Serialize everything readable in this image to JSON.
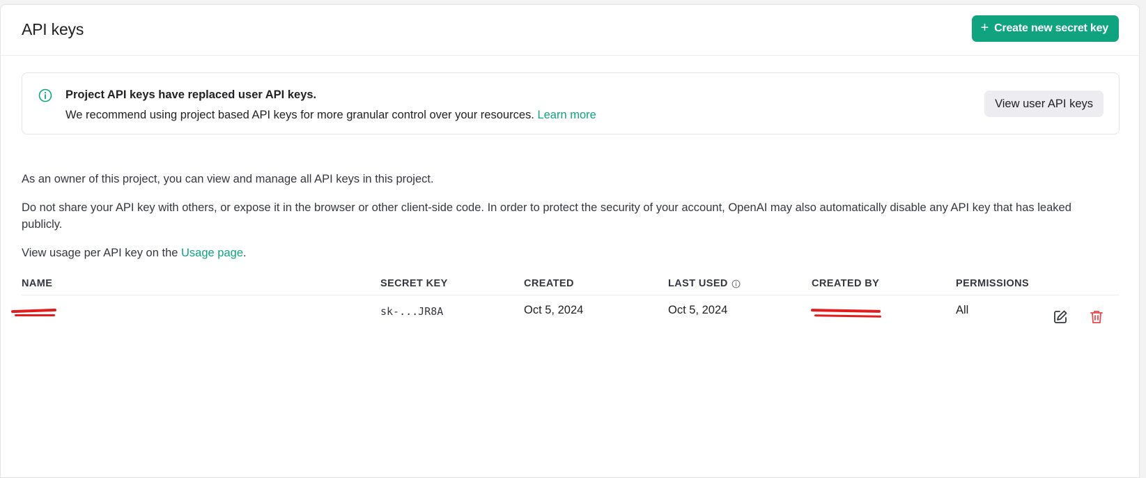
{
  "header": {
    "title": "API keys",
    "create_button_label": "Create new secret key"
  },
  "notice": {
    "title": "Project API keys have replaced user API keys.",
    "body": "We recommend using project based API keys for more granular control over your resources.",
    "link_label": "Learn more",
    "view_user_keys_label": "View user API keys"
  },
  "info": {
    "owner_text": "As an owner of this project, you can view and manage all API keys in this project.",
    "warning_text": "Do not share your API key with others, or expose it in the browser or other client-side code. In order to protect the security of your account, OpenAI may also automatically disable any API key that has leaked publicly.",
    "usage_prefix": "View usage per API key on the ",
    "usage_link": "Usage page",
    "usage_suffix": "."
  },
  "table": {
    "columns": [
      "NAME",
      "SECRET KEY",
      "CREATED",
      "LAST USED",
      "CREATED BY",
      "PERMISSIONS"
    ],
    "rows": [
      {
        "name": "",
        "secret_key": "sk-...JR8A",
        "created": "Oct 5, 2024",
        "last_used": "Oct 5, 2024",
        "created_by": "",
        "permissions": "All"
      }
    ]
  },
  "colors": {
    "accent": "#10a37f",
    "danger": "#e5484d",
    "redaction": "#e11d1d"
  },
  "icons": {
    "create": "plus-icon",
    "notice": "info-circle-icon",
    "last_used_hint": "info-circle-icon",
    "edit": "pencil-square-icon",
    "delete": "trash-icon"
  }
}
